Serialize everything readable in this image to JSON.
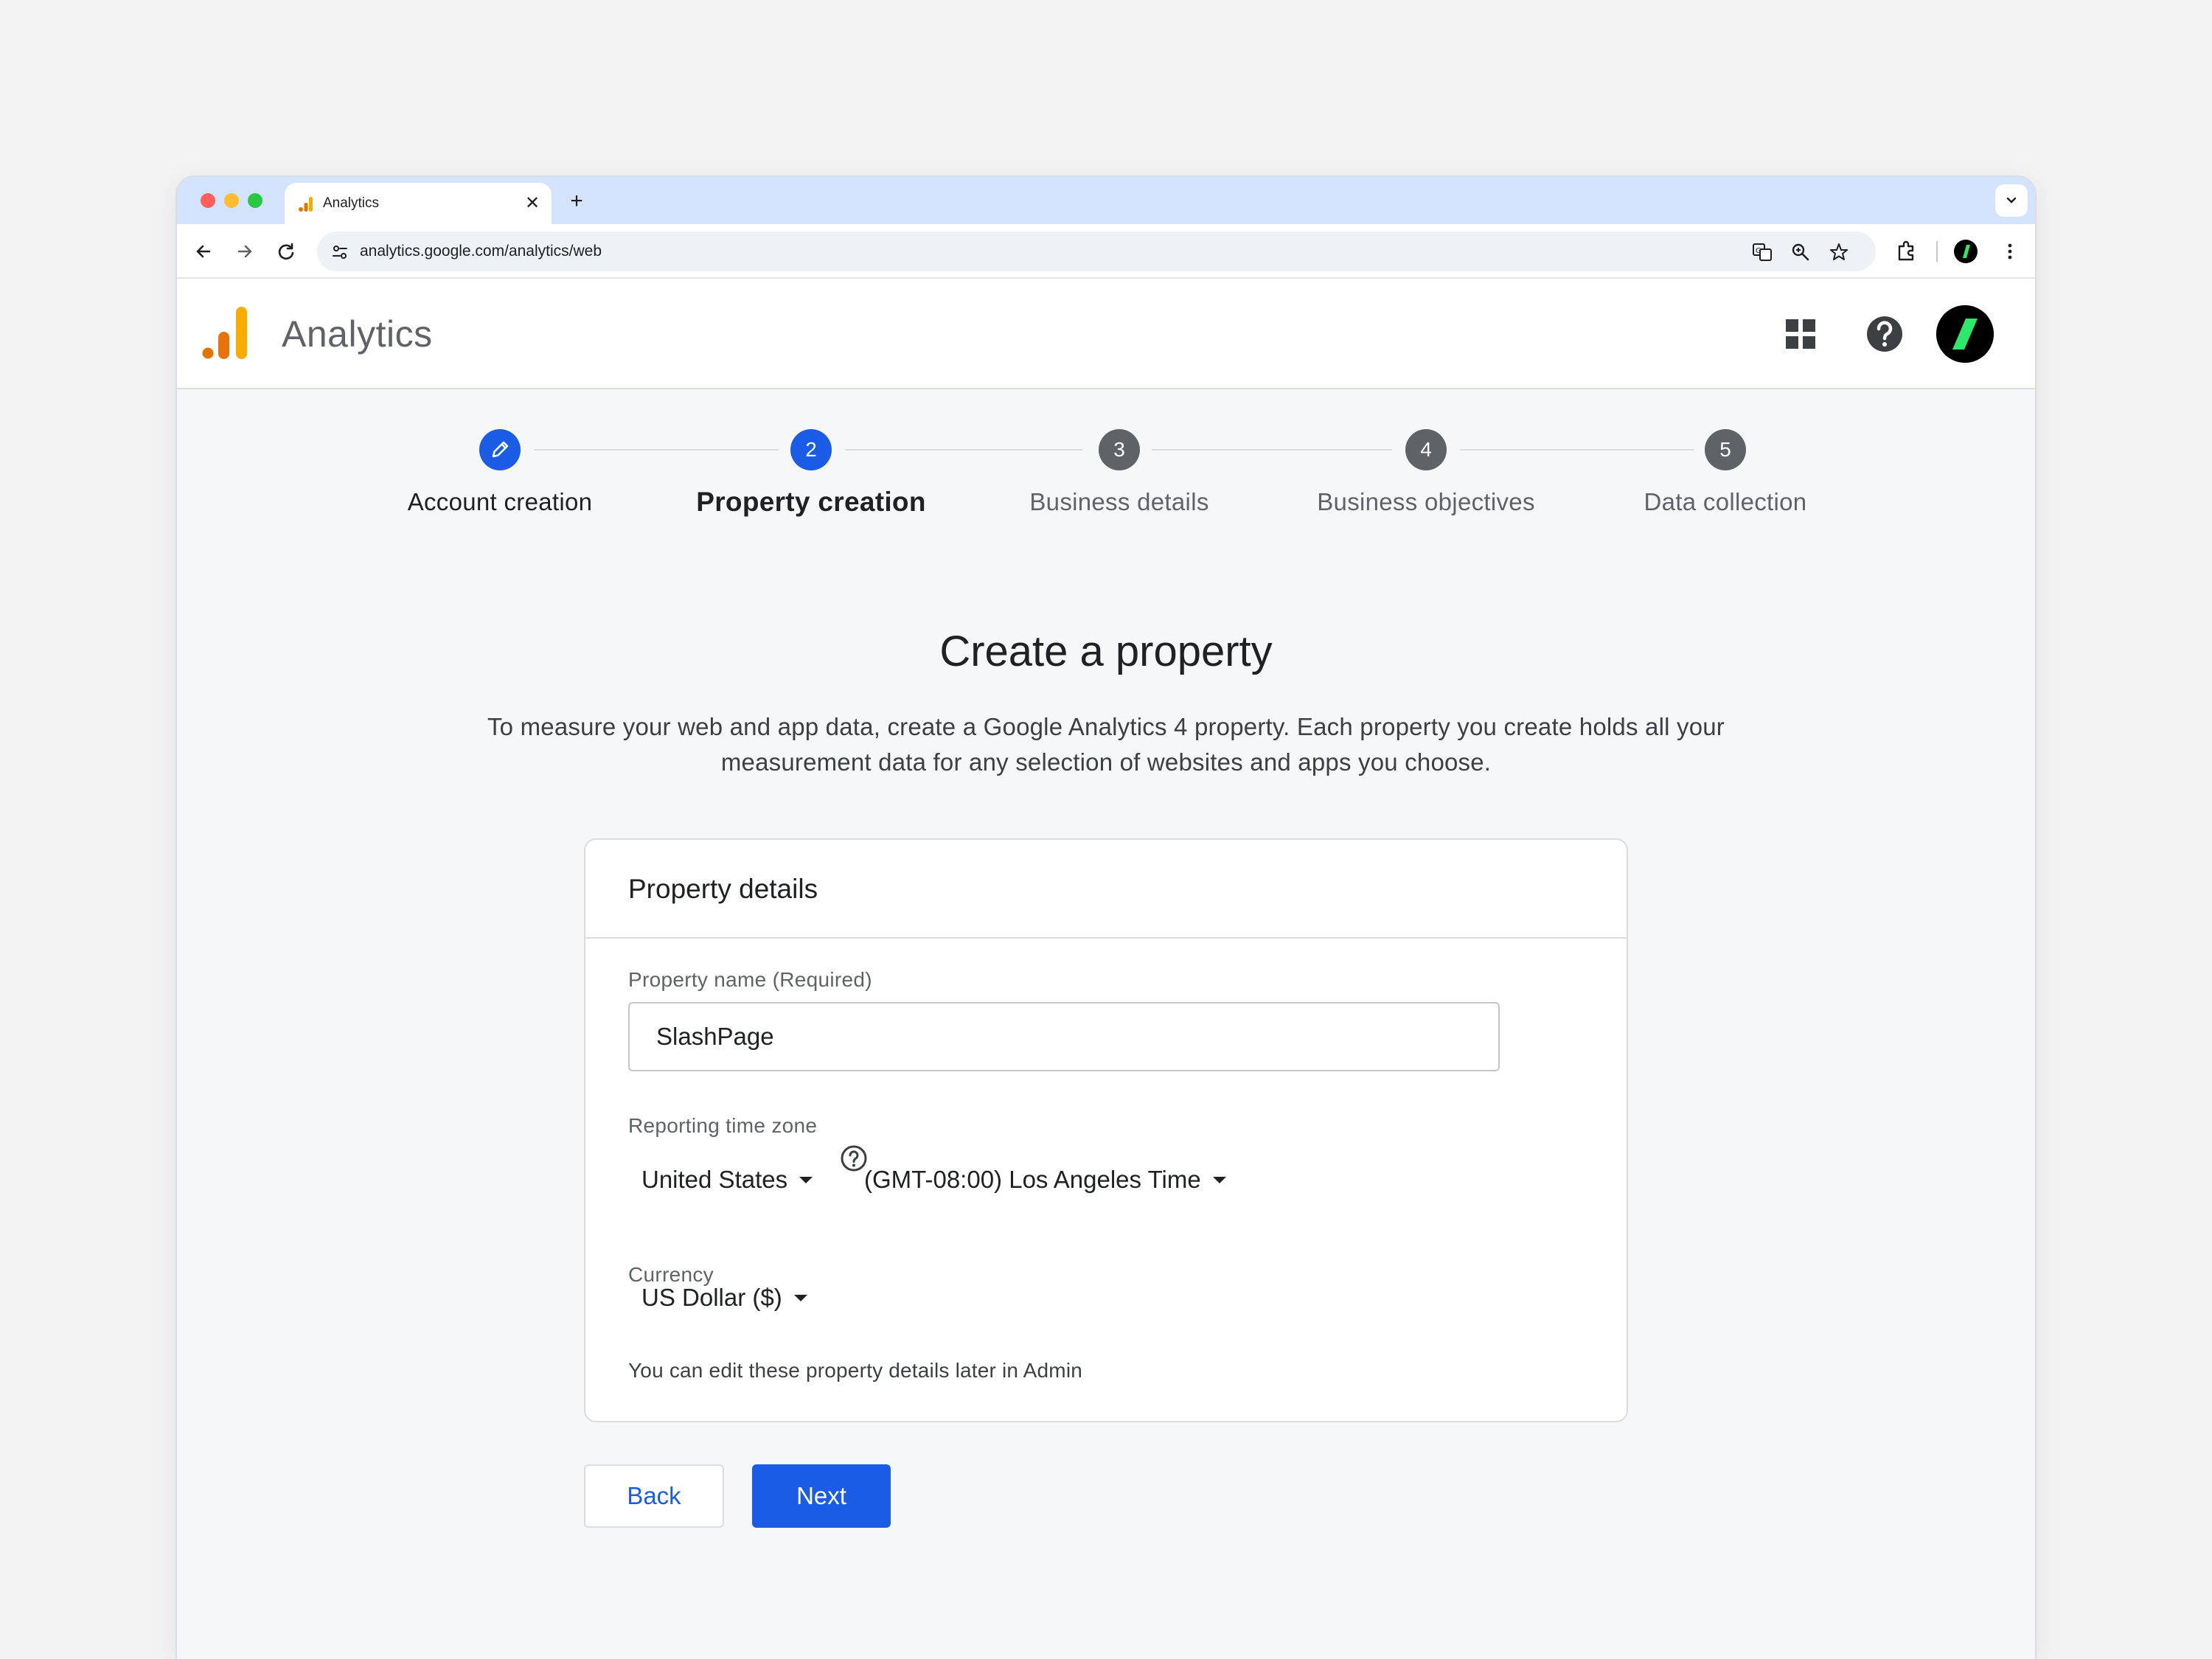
{
  "browser": {
    "tab_title": "Analytics",
    "url": "analytics.google.com/analytics/web"
  },
  "app": {
    "name": "Analytics"
  },
  "stepper": {
    "steps": [
      {
        "number": "",
        "label": "Account creation",
        "state": "done"
      },
      {
        "number": "2",
        "label": "Property creation",
        "state": "current"
      },
      {
        "number": "3",
        "label": "Business details",
        "state": "pending"
      },
      {
        "number": "4",
        "label": "Business objectives",
        "state": "pending"
      },
      {
        "number": "5",
        "label": "Data collection",
        "state": "pending"
      }
    ]
  },
  "page": {
    "title": "Create a property",
    "description": "To measure your web and app data, create a Google Analytics 4 property. Each property you create holds all your measurement data for any selection of websites and apps you choose."
  },
  "card": {
    "title": "Property details",
    "property_name_label": "Property name (Required)",
    "property_name_value": "SlashPage",
    "timezone_label": "Reporting time zone",
    "country_value": "United States",
    "timezone_value": "(GMT-08:00) Los Angeles Time",
    "currency_label": "Currency",
    "currency_value": "US Dollar ($)",
    "note": "You can edit these property details later in Admin"
  },
  "actions": {
    "back_label": "Back",
    "next_label": "Next"
  },
  "colors": {
    "primary": "#1a5ce6",
    "tab_strip": "#d3e3fd",
    "avatar_accent": "#2ee86b"
  },
  "icons": [
    "close-icon",
    "plus-icon",
    "chevron-down-icon",
    "back-arrow-icon",
    "forward-arrow-icon",
    "reload-icon",
    "tune-icon",
    "translate-icon",
    "zoom-icon",
    "star-icon",
    "extensions-icon",
    "more-vert-icon",
    "apps-grid-icon",
    "help-icon",
    "pencil-icon"
  ]
}
